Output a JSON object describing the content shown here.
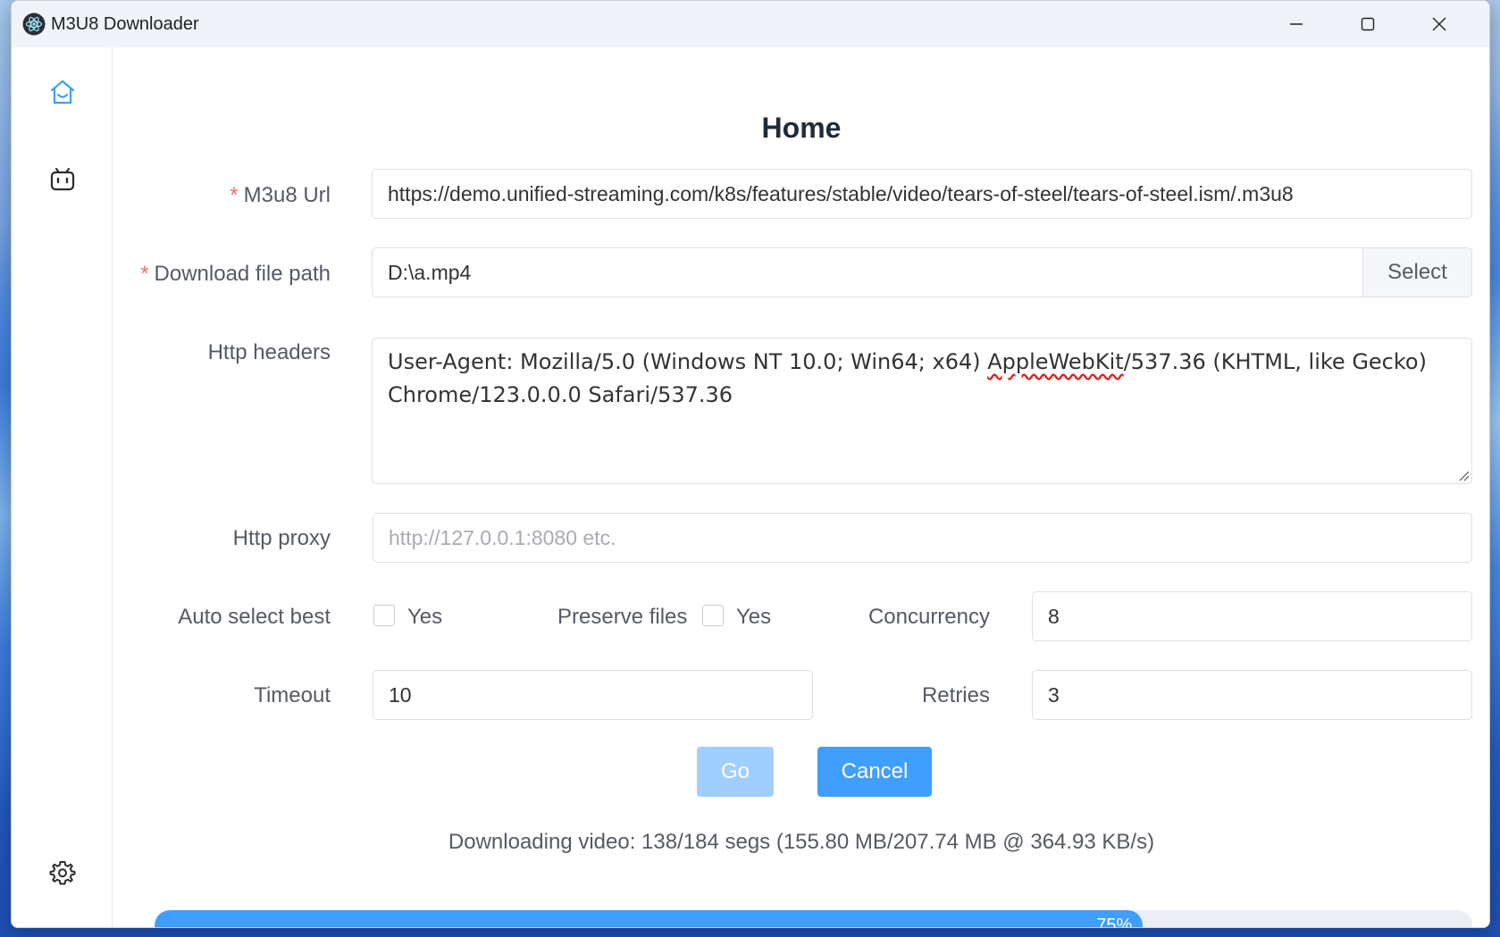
{
  "window": {
    "title": "M3U8 Downloader",
    "icon": "electron-logo-icon"
  },
  "sidebar": {
    "items": [
      {
        "name": "home",
        "icon": "home-icon",
        "active": true
      },
      {
        "name": "bilibili",
        "icon": "tv-robot-icon",
        "active": false
      },
      {
        "name": "settings",
        "icon": "gear-icon",
        "active": false
      }
    ]
  },
  "page": {
    "title": "Home"
  },
  "form": {
    "url_label": "M3u8 Url",
    "url_value": "https://demo.unified-streaming.com/k8s/features/stable/video/tears-of-steel/tears-of-steel.ism/.m3u8",
    "path_label": "Download file path",
    "path_value": "D:\\a.mp4",
    "select_label": "Select",
    "headers_label": "Http headers",
    "headers_line1_a": "User-Agent: Mozilla/5.0 (Windows NT 10.0; Win64; x64) ",
    "headers_line1_spell": "AppleWebKit",
    "headers_line1_b": "/537.36 (KHTML, like Gecko)",
    "headers_line2": "Chrome/123.0.0.0 Safari/537.36",
    "proxy_label": "Http proxy",
    "proxy_placeholder": "http://127.0.0.1:8080 etc.",
    "proxy_value": "",
    "auto_select_label": "Auto select best",
    "auto_select_option": "Yes",
    "auto_select_checked": false,
    "preserve_label": "Preserve files",
    "preserve_option": "Yes",
    "preserve_checked": false,
    "concurrency_label": "Concurrency",
    "concurrency_value": "8",
    "timeout_label": "Timeout",
    "timeout_value": "10",
    "retries_label": "Retries",
    "retries_value": "3"
  },
  "actions": {
    "go_label": "Go",
    "go_disabled": true,
    "cancel_label": "Cancel"
  },
  "status": {
    "text": "Downloading video: 138/184 segs (155.80 MB/207.74 MB @ 364.93 KB/s)",
    "progress_percent": 75,
    "progress_label": "75%"
  },
  "colors": {
    "accent": "#409eff",
    "accent_disabled": "#a0cfff",
    "required": "#f56c6c"
  }
}
